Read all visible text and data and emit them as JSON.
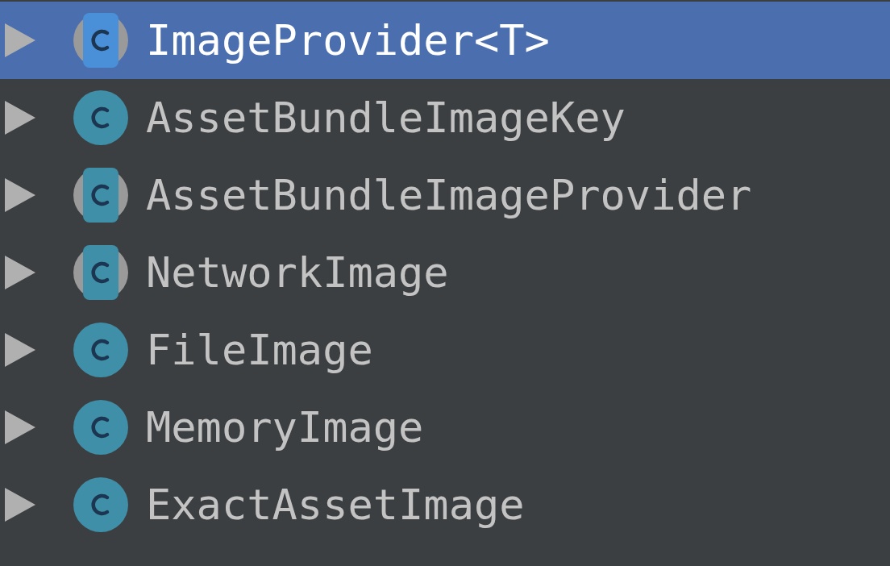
{
  "tree": {
    "items": [
      {
        "label": "ImageProvider<T>",
        "kind": "abstract",
        "selected": true,
        "expanded": false
      },
      {
        "label": "AssetBundleImageKey",
        "kind": "class",
        "selected": false,
        "expanded": false
      },
      {
        "label": "AssetBundleImageProvider",
        "kind": "abstract",
        "selected": false,
        "expanded": false
      },
      {
        "label": "NetworkImage",
        "kind": "abstract",
        "selected": false,
        "expanded": false
      },
      {
        "label": "FileImage",
        "kind": "class",
        "selected": false,
        "expanded": false
      },
      {
        "label": "MemoryImage",
        "kind": "class",
        "selected": false,
        "expanded": false
      },
      {
        "label": "ExactAssetImage",
        "kind": "class",
        "selected": false,
        "expanded": false
      }
    ]
  }
}
